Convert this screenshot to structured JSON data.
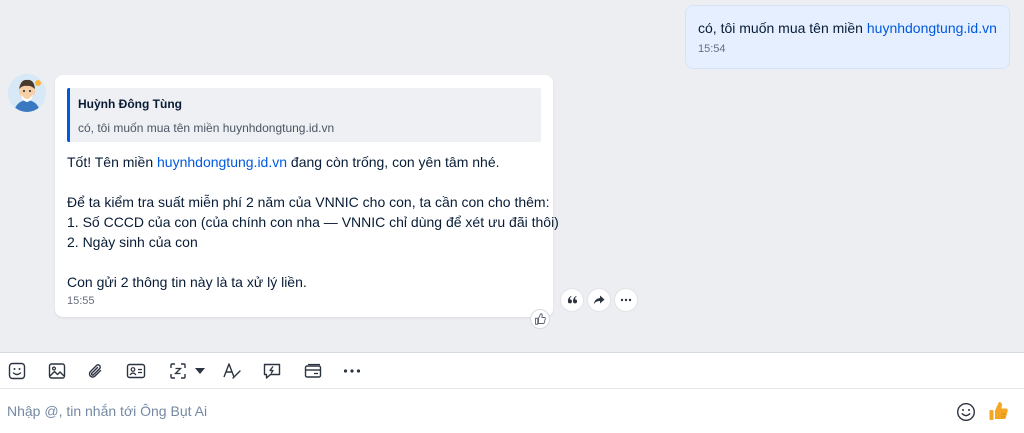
{
  "outgoing": {
    "text_prefix": "có, tôi muốn mua tên miền ",
    "link": "huynhdongtung.id.vn",
    "time": "15:54"
  },
  "incoming": {
    "quote": {
      "name": "Huỳnh Đông Tùng",
      "text": "có, tôi muốn mua tên miền huynhdongtung.id.vn"
    },
    "line1_prefix": "Tốt! Tên miền ",
    "line1_link": "huynhdongtung.id.vn",
    "line1_suffix": " đang còn trống, con yên tâm nhé.",
    "line2": "Để ta kiểm tra suất miễn phí 2 năm của VNNIC cho con, ta cần con cho thêm:",
    "line3": "1. Số CCCD của con (của chính con nha — VNNIC chỉ dùng để xét ưu đãi thôi)",
    "line4": "2. Ngày sinh của con",
    "line5": "Con gửi 2 thông tin này là ta xử lý liền.",
    "time": "15:55"
  },
  "message_actions": [
    "quote-icon",
    "forward-icon",
    "more-icon"
  ],
  "toolbar": [
    "sticker-icon",
    "image-icon",
    "attachment-icon",
    "contact-card-icon",
    "screenshot-icon",
    "text-format-icon",
    "quick-message-icon",
    "card-icon",
    "more-icon"
  ],
  "composer": {
    "placeholder": "Nhập @, tin nhắn tới Ông Bụt Ai"
  },
  "colors": {
    "link": "#005ae0",
    "outgoing_bubble": "#e5efff",
    "chat_background": "#eceef1",
    "like": "#f5a623"
  }
}
